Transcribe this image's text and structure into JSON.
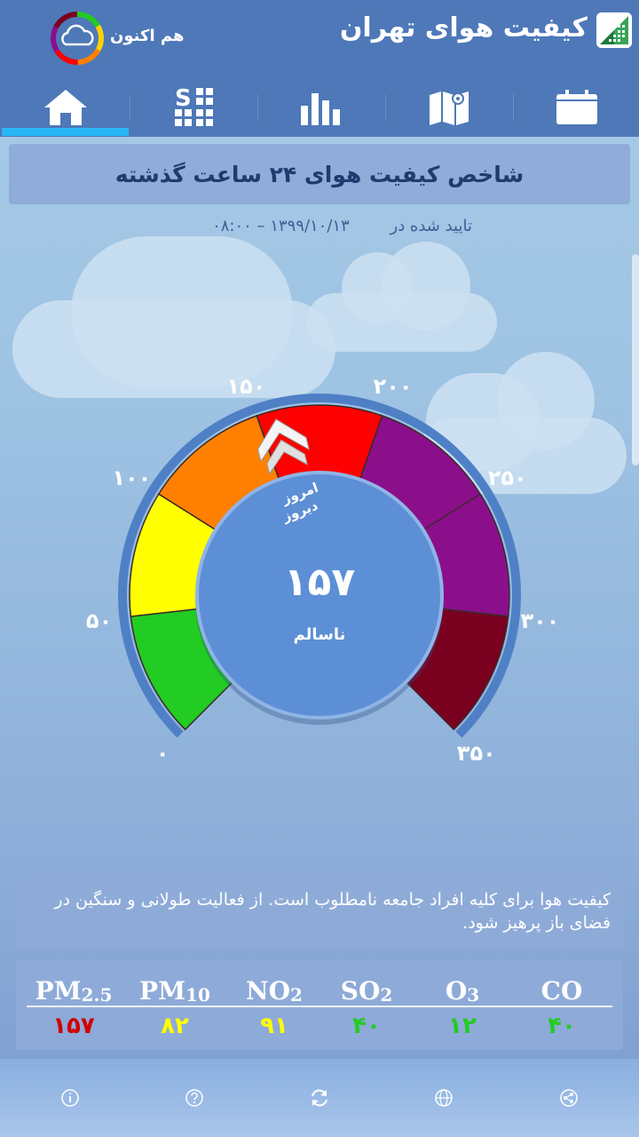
{
  "header": {
    "title": "کیفیت هوای تهران",
    "now_label": "هم اکنون"
  },
  "tabs": [
    {
      "name": "home",
      "active": true
    },
    {
      "name": "stations"
    },
    {
      "name": "charts"
    },
    {
      "name": "map"
    },
    {
      "name": "calendar"
    }
  ],
  "main": {
    "card_title": "شاخص کیفیت هوای ۲۴ ساعت گذشته",
    "confirm_label": "تایید شده در",
    "confirm_value": "۱۳۹۹/۱۰/۱۳ – ۰۸:۰۰"
  },
  "gauge": {
    "value": 157,
    "value_text": "۱۵۷",
    "status": "ناسالم",
    "today_label": "امروز",
    "yesterday_label": "دیروز",
    "max": 350,
    "ticks": [
      "۰",
      "۵۰",
      "۱۰۰",
      "۱۵۰",
      "۲۰۰",
      "۲۵۰",
      "۳۰۰",
      "۳۵۰"
    ],
    "bands": [
      {
        "from": 0,
        "to": 50,
        "color": "#22cc22"
      },
      {
        "from": 50,
        "to": 100,
        "color": "#ffff00"
      },
      {
        "from": 100,
        "to": 150,
        "color": "#ff8000"
      },
      {
        "from": 150,
        "to": 200,
        "color": "#ff0000"
      },
      {
        "from": 200,
        "to": 300,
        "color": "#8b0f8b"
      },
      {
        "from": 300,
        "to": 350,
        "color": "#7a0020"
      }
    ]
  },
  "advice": "کیفیت هوا برای کلیه افراد جامعه نامطلوب است. از فعالیت طولانی و سنگین در فضای باز پرهیز شود.",
  "pollutants": [
    {
      "base": "PM",
      "sub": "2.5",
      "value": "۱۵۷",
      "color": "#d00000"
    },
    {
      "base": "PM",
      "sub": "10",
      "value": "۸۲",
      "color": "#ffff00"
    },
    {
      "base": "NO",
      "sub": "2",
      "value": "۹۱",
      "color": "#ffff00"
    },
    {
      "base": "SO",
      "sub": "2",
      "value": "۴۰",
      "color": "#22cc22"
    },
    {
      "base": "O",
      "sub": "3",
      "value": "۱۲",
      "color": "#22cc22"
    },
    {
      "base": "CO",
      "sub": "",
      "value": "۴۰",
      "color": "#22cc22"
    }
  ],
  "bottom_bar": [
    "info-icon",
    "help-icon",
    "refresh-icon",
    "globe-icon",
    "share-icon"
  ]
}
